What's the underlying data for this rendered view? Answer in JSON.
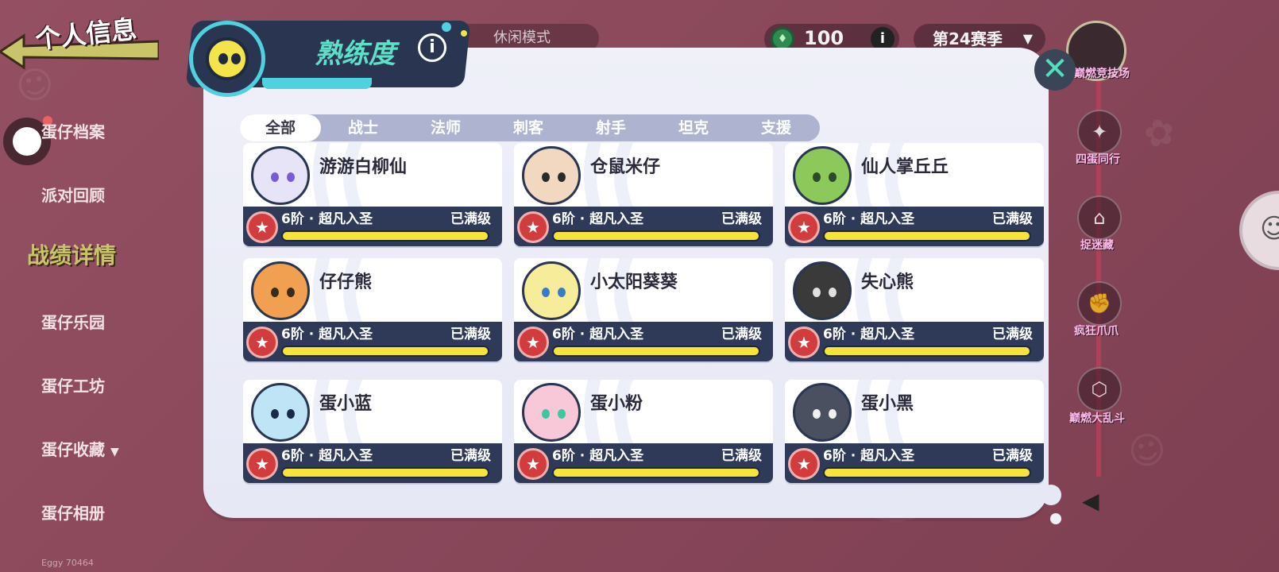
{
  "header": {
    "back_title": "个人信息",
    "panel_title": "熟练度",
    "mode_label": "休闲模式",
    "currency_value": "100",
    "season_label": "第24赛季"
  },
  "sidebar": {
    "items": [
      {
        "label": "蛋仔档案"
      },
      {
        "label": "派对回顾"
      },
      {
        "label": "战绩详情"
      },
      {
        "label": "蛋仔乐园"
      },
      {
        "label": "蛋仔工坊"
      },
      {
        "label": "蛋仔收藏"
      },
      {
        "label": "蛋仔相册"
      }
    ],
    "footer_id": "Eggy 70464"
  },
  "right_nav": {
    "items": [
      {
        "label": "巅燃竞技场"
      },
      {
        "label": "四蛋同行"
      },
      {
        "label": "捉迷藏"
      },
      {
        "label": "疯狂爪爪"
      },
      {
        "label": "巅燃大乱斗"
      }
    ]
  },
  "tabs": [
    {
      "label": "全部",
      "active": true
    },
    {
      "label": "战士"
    },
    {
      "label": "法师"
    },
    {
      "label": "刺客"
    },
    {
      "label": "射手"
    },
    {
      "label": "坦克"
    },
    {
      "label": "支援"
    }
  ],
  "cards": [
    {
      "name": "游游白柳仙",
      "rank": "6阶 · 超凡入圣",
      "level": "已满级",
      "progress": 1.0,
      "avatar_color": "#e8e4f8",
      "eye_color": "#7a5ad8"
    },
    {
      "name": "仓鼠米仔",
      "rank": "6阶 · 超凡入圣",
      "level": "已满级",
      "progress": 1.0,
      "avatar_color": "#f2d8c0",
      "eye_color": "#2a2a2a"
    },
    {
      "name": "仙人掌丘丘",
      "rank": "6阶 · 超凡入圣",
      "level": "已满级",
      "progress": 1.0,
      "avatar_color": "#8cc85a",
      "eye_color": "#2a4a2a"
    },
    {
      "name": "仔仔熊",
      "rank": "6阶 · 超凡入圣",
      "level": "已满级",
      "progress": 1.0,
      "avatar_color": "#f0a050",
      "eye_color": "#3a2a1a"
    },
    {
      "name": "小太阳葵葵",
      "rank": "6阶 · 超凡入圣",
      "level": "已满级",
      "progress": 1.0,
      "avatar_color": "#f6ec9a",
      "eye_color": "#3a7ac8"
    },
    {
      "name": "失心熊",
      "rank": "6阶 · 超凡入圣",
      "level": "已满级",
      "progress": 1.0,
      "avatar_color": "#3a3a3a",
      "eye_color": "#e0e0e0"
    },
    {
      "name": "蛋小蓝",
      "rank": "6阶 · 超凡入圣",
      "level": "已满级",
      "progress": 1.0,
      "avatar_color": "#bfe4f6",
      "eye_color": "#1a2a4a"
    },
    {
      "name": "蛋小粉",
      "rank": "6阶 · 超凡入圣",
      "level": "已满级",
      "progress": 1.0,
      "avatar_color": "#f8c8d8",
      "eye_color": "#3ac8a0"
    },
    {
      "name": "蛋小黑",
      "rank": "6阶 · 超凡入圣",
      "level": "已满级",
      "progress": 1.0,
      "avatar_color": "#4a5060",
      "eye_color": "#f0f0f0"
    }
  ],
  "colors": {
    "panel_bg": "#eff0f8",
    "header_bg": "#2a3552",
    "accent_teal": "#4fd1e0",
    "progress_yellow": "#f7e43a",
    "rank_badge_red": "#d23c3c"
  },
  "icons": {
    "close": "close-icon",
    "info": "info-icon",
    "back": "back-arrow-icon",
    "collapse": "chevron-left-icon",
    "dropdown": "chevron-down-icon",
    "currency": "gem-icon"
  }
}
